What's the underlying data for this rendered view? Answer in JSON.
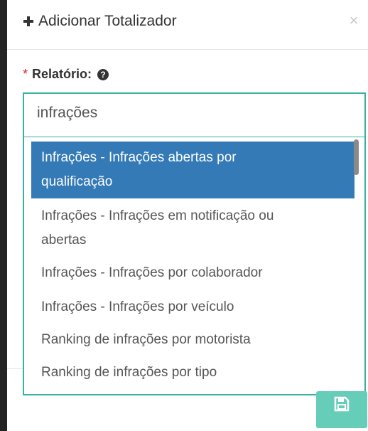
{
  "modal": {
    "title": "Adicionar Totalizador",
    "close_label": "×"
  },
  "form": {
    "report_label": "Relatório:",
    "required_mark": "*",
    "help_glyph": "?",
    "search_value": "infrações"
  },
  "dropdown": {
    "options": [
      {
        "line1": "Infrações - Infrações abertas por",
        "line2": "qualificação",
        "selected": true
      },
      {
        "line1": "Infrações - Infrações em notificação ou",
        "line2": "abertas",
        "selected": false
      },
      {
        "line1": "Infrações - Infrações por colaborador",
        "line2": "",
        "selected": false
      },
      {
        "line1": "Infrações - Infrações por veículo",
        "line2": "",
        "selected": false
      },
      {
        "line1": "Ranking de infrações por motorista",
        "line2": "",
        "selected": false
      },
      {
        "line1": "Ranking de infrações por tipo",
        "line2": "",
        "selected": false
      }
    ]
  },
  "icons": {
    "add": "plus-icon",
    "close": "close-icon",
    "help": "question-circle-icon",
    "save": "floppy-disk-icon"
  },
  "colors": {
    "accent_border": "#3ab0a3",
    "selected_bg": "#337ab7",
    "save_button": "#66cdb9",
    "required": "#e02020"
  }
}
